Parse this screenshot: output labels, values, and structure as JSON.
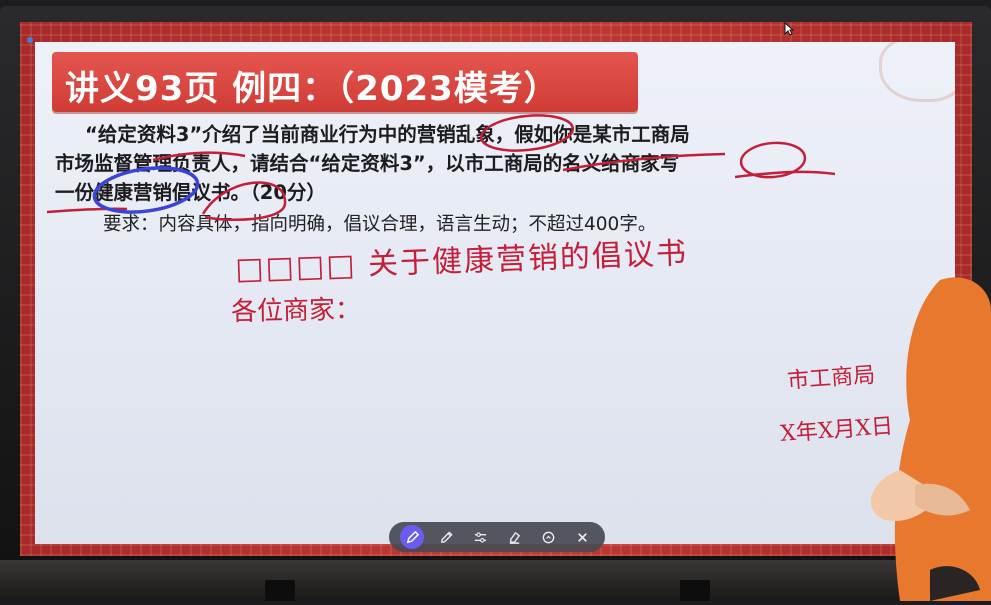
{
  "title": "讲义93页  例四：（2023模考）",
  "question": {
    "line1": "“给定资料3”介绍了当前商业行为中的营销乱象，假如你是某市工商局",
    "line2": "市场监督管理负责人，请结合“给定资料3”，以市工商局的名义给商家写",
    "line3": "一份健康营销倡议书。（20分）"
  },
  "requirement": "要求：内容具体，指向明确，倡议合理，语言生动；不超过400字。",
  "handwriting": {
    "heading": "□□□□ 关于健康营销的倡议书",
    "salutation": "各位商家：",
    "signature": "市工商局",
    "date": "X年X月X日"
  },
  "toolbar": {
    "tools": [
      {
        "name": "pen-tool",
        "icon": "pen-icon",
        "active": true
      },
      {
        "name": "pencil-tool",
        "icon": "pencil-icon"
      },
      {
        "name": "adjust-tool",
        "icon": "sliders-icon"
      },
      {
        "name": "eraser-tool",
        "icon": "eraser-icon"
      },
      {
        "name": "clear-tool",
        "icon": "clear-icon"
      },
      {
        "name": "close-tool",
        "icon": "close-icon"
      }
    ]
  },
  "colors": {
    "frame": "#c23a34",
    "title_bg": "#d9463f",
    "screen_bg": "#e8ebf4",
    "ink_red": "#c41f38",
    "ink_blue": "#3b44d6",
    "toolbar_bg": "#484a52",
    "toolbar_active": "#6a5cf0"
  }
}
